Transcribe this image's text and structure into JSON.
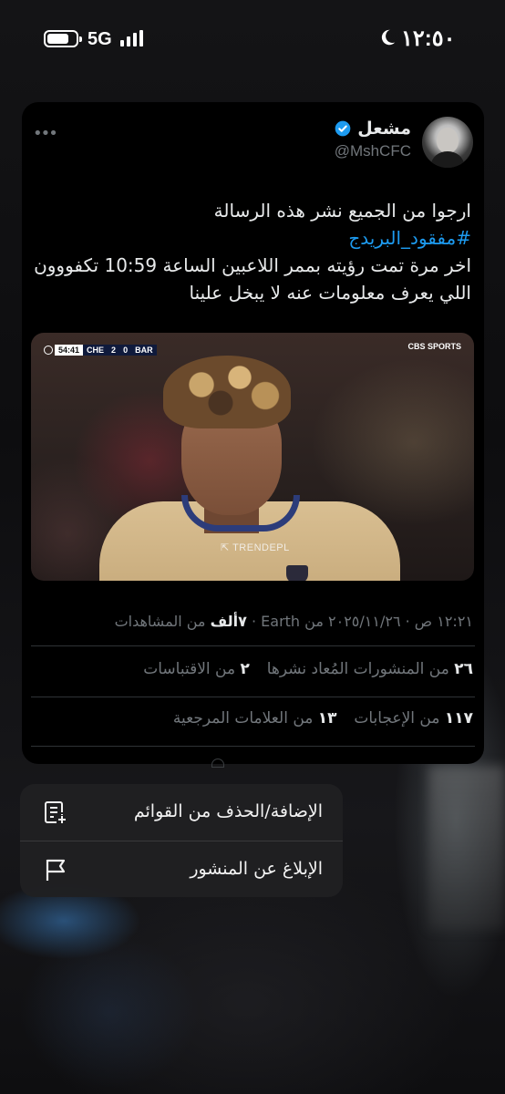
{
  "status_bar": {
    "network": "5G",
    "time": "١٢:٥٠",
    "battery_level": 0.75
  },
  "tweet": {
    "display_name": "مشعل",
    "handle": "@MshCFC",
    "text_line1": "ارجوا من الجميع نشر هذه الرسالة",
    "hashtag": "#مفقود_البريدج",
    "text_line3": "اخر مرة تمت رؤيته بممر اللاعبين الساعة 10:59  تكفووون",
    "text_line4": "اللي يعرف معلومات عنه لا يبخل علينا",
    "media": {
      "match_clock": "54:41",
      "home_team": "CHE",
      "home_score": "2",
      "away_score": "0",
      "away_team": "BAR",
      "broadcaster": "CBS SPORTS",
      "watermark": "TRENDEPL"
    },
    "meta": {
      "time": "١٢:٢١ ص",
      "date": "٢٠٢٥/١١/٢٦",
      "from": "من Earth",
      "views_count": "٧ألف",
      "views_label": "من المشاهدات"
    },
    "stats": {
      "reposts_count": "٢٦",
      "reposts_label": "من المنشورات المُعاد نشرها",
      "quotes_count": "٢",
      "quotes_label": "من الاقتباسات",
      "likes_count": "١١٧",
      "likes_label": "من الإعجابات",
      "bookmarks_count": "١٣",
      "bookmarks_label": "من العلامات المرجعية"
    }
  },
  "menu": {
    "add_remove_lists": "الإضافة/الحذف من القوائم",
    "report_post": "الإبلاغ عن المنشور"
  },
  "icons": {
    "more": "more-icon",
    "verified": "verified-badge-icon",
    "list": "list-add-icon",
    "flag": "flag-icon"
  },
  "colors": {
    "accent": "#1d9bf0",
    "muted": "#71767b"
  }
}
